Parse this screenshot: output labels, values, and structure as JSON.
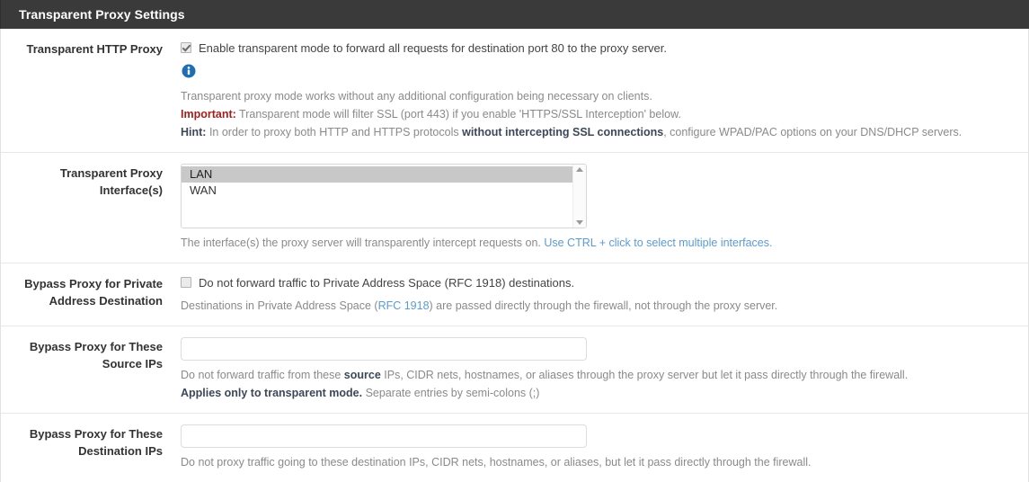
{
  "header": {
    "title": "Transparent Proxy Settings"
  },
  "rows": {
    "transparent_http_proxy": {
      "label": "Transparent HTTP Proxy",
      "checkbox_label": "Enable transparent mode to forward all requests for destination port 80 to the proxy server.",
      "checked": true,
      "info_icon": "info-circle-icon",
      "help_line1": "Transparent proxy mode works without any additional configuration being necessary on clients.",
      "help_important_label": "Important:",
      "help_important_text": " Transparent mode will filter SSL (port 443) if you enable 'HTTPS/SSL Interception' below.",
      "help_hint_label": "Hint:",
      "help_hint_text_a": " In order to proxy both HTTP and HTTPS protocols ",
      "help_hint_bold": "without intercepting SSL connections",
      "help_hint_text_b": ", configure WPAD/PAC options on your DNS/DHCP servers."
    },
    "transparent_proxy_interfaces": {
      "label": "Transparent Proxy Interface(s)",
      "options": [
        {
          "label": "LAN",
          "selected": true
        },
        {
          "label": "WAN",
          "selected": false
        }
      ],
      "help_text": "The interface(s) the proxy server will transparently intercept requests on. ",
      "help_link": "Use CTRL + click to select multiple interfaces."
    },
    "bypass_private_address": {
      "label": "Bypass Proxy for Private Address Destination",
      "checkbox_label": "Do not forward traffic to Private Address Space (RFC 1918) destinations.",
      "checked": false,
      "help_text_a": "Destinations in Private Address Space (",
      "help_link": "RFC 1918",
      "help_text_b": ") are passed directly through the firewall, not through the proxy server."
    },
    "bypass_source_ips": {
      "label": "Bypass Proxy for These Source IPs",
      "value": "",
      "help_text_a": "Do not forward traffic from these ",
      "help_bold_a": "source",
      "help_text_b": " IPs, CIDR nets, hostnames, or aliases through the proxy server but let it pass directly through the firewall.",
      "help_bold_b": "Applies only to transparent mode.",
      "help_text_c": " Separate entries by semi-colons (;)"
    },
    "bypass_destination_ips": {
      "label": "Bypass Proxy for These Destination IPs",
      "value": "",
      "help_text": "Do not proxy traffic going to these destination IPs, CIDR nets, hostnames, or aliases, but let it pass directly through the firewall."
    }
  },
  "colors": {
    "header_bg": "#3a3a3a",
    "link": "#5b9bd5",
    "important": "#a02020",
    "hint": "#3c4858",
    "help_text": "#8a8a8a",
    "selected_option_bg": "#c8c8c8"
  }
}
